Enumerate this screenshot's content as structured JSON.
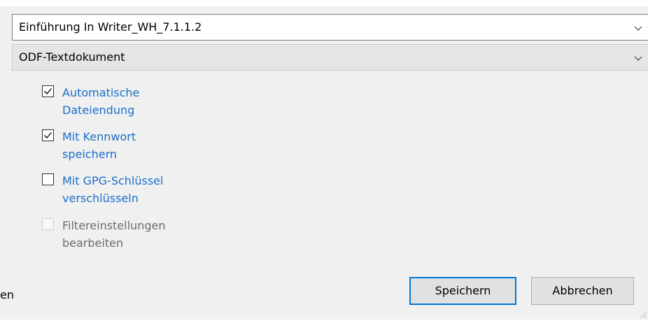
{
  "dialog": {
    "filename": {
      "value": "Einführung In Writer_WH_7.1.1.2",
      "icon": "chevron-down-icon"
    },
    "filetype": {
      "value": "ODF-Textdokument",
      "icon": "chevron-down-icon"
    },
    "options": [
      {
        "line1": "Automatische",
        "line2": "Dateiendung",
        "checked": true,
        "enabled": true
      },
      {
        "line1": "Mit Kennwort",
        "line2": "speichern",
        "checked": true,
        "enabled": true
      },
      {
        "line1": "Mit GPG-Schlüssel",
        "line2": "verschlüsseln",
        "checked": false,
        "enabled": true
      },
      {
        "line1": "Filtereinstellungen",
        "line2": "bearbeiten",
        "checked": false,
        "enabled": false
      }
    ],
    "cut_label": "en",
    "buttons": {
      "save_label": "Speichern",
      "cancel_label": "Abbrechen"
    },
    "colors": {
      "accent": "#0078d7",
      "link_text": "#1a6fc9",
      "disabled_text": "#6d6d6d"
    }
  }
}
